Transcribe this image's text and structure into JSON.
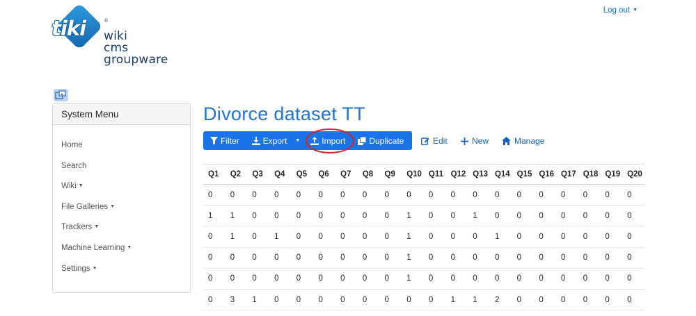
{
  "logo": {
    "tiki": "tiki",
    "registered": "®",
    "line1": "wiki",
    "line2": "cms",
    "line3": "groupware"
  },
  "header": {
    "logout_label": "Log out"
  },
  "sidebar": {
    "title": "System Menu",
    "items": [
      {
        "label": "Home",
        "has_caret": false
      },
      {
        "label": "Search",
        "has_caret": false
      },
      {
        "label": "Wiki",
        "has_caret": true
      },
      {
        "label": "File Galleries",
        "has_caret": true
      },
      {
        "label": "Trackers",
        "has_caret": true
      },
      {
        "label": "Machine Learning",
        "has_caret": true
      },
      {
        "label": "Settings",
        "has_caret": true
      }
    ]
  },
  "page": {
    "title": "Divorce dataset TT"
  },
  "toolbar": {
    "filter_label": "Filter",
    "export_label": "Export",
    "import_label": "Import",
    "duplicate_label": "Duplicate",
    "edit_label": "Edit",
    "new_label": "New",
    "manage_label": "Manage",
    "primary_color": "#1a73e8",
    "highlight_color": "#e01e1e"
  },
  "table": {
    "columns": [
      "Q1",
      "Q2",
      "Q3",
      "Q4",
      "Q5",
      "Q6",
      "Q7",
      "Q8",
      "Q9",
      "Q10",
      "Q11",
      "Q12",
      "Q13",
      "Q14",
      "Q15",
      "Q16",
      "Q17",
      "Q18",
      "Q19",
      "Q20"
    ],
    "rows": [
      [
        "0",
        "0",
        "0",
        "0",
        "0",
        "0",
        "0",
        "0",
        "0",
        "0",
        "0",
        "0",
        "0",
        "0",
        "0",
        "0",
        "0",
        "0",
        "0",
        "0"
      ],
      [
        "1",
        "1",
        "0",
        "0",
        "0",
        "0",
        "0",
        "0",
        "0",
        "1",
        "0",
        "0",
        "1",
        "0",
        "0",
        "0",
        "0",
        "0",
        "0",
        "0"
      ],
      [
        "0",
        "1",
        "0",
        "1",
        "0",
        "0",
        "0",
        "0",
        "0",
        "1",
        "0",
        "0",
        "0",
        "1",
        "0",
        "0",
        "0",
        "0",
        "0",
        "0"
      ],
      [
        "0",
        "0",
        "0",
        "0",
        "0",
        "0",
        "0",
        "0",
        "0",
        "1",
        "0",
        "0",
        "0",
        "0",
        "0",
        "0",
        "0",
        "0",
        "0",
        "0"
      ],
      [
        "0",
        "0",
        "0",
        "0",
        "0",
        "0",
        "0",
        "0",
        "0",
        "1",
        "0",
        "0",
        "0",
        "0",
        "0",
        "0",
        "0",
        "0",
        "0",
        "0"
      ],
      [
        "0",
        "3",
        "1",
        "0",
        "0",
        "0",
        "0",
        "0",
        "0",
        "0",
        "0",
        "1",
        "1",
        "2",
        "0",
        "0",
        "0",
        "0",
        "0",
        "0"
      ]
    ]
  }
}
